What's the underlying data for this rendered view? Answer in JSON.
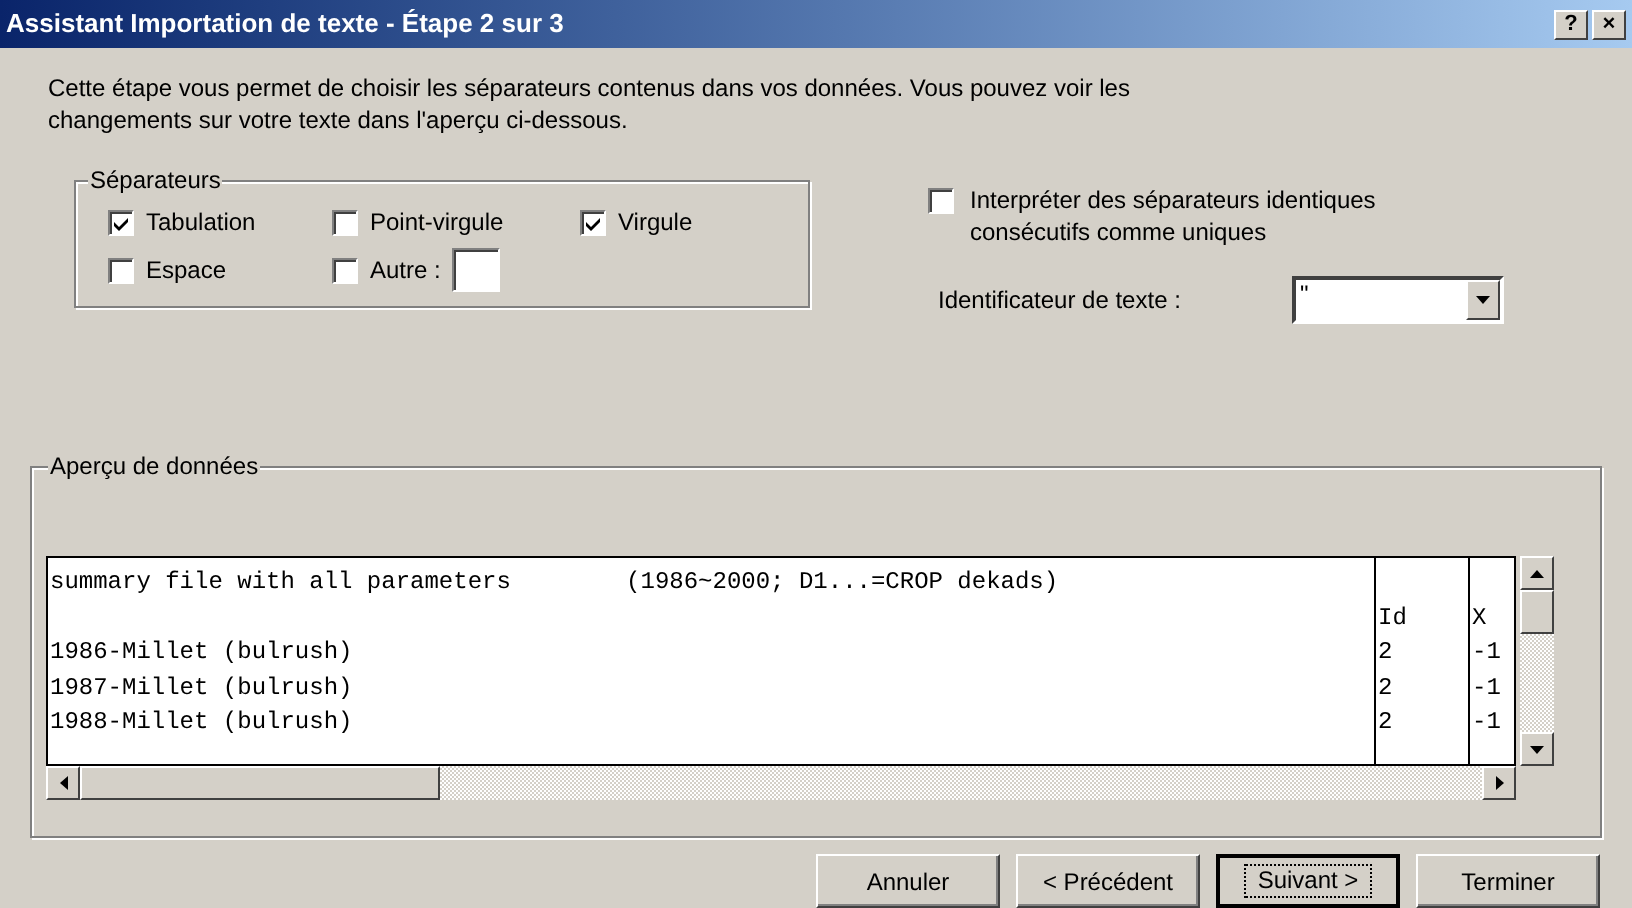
{
  "window": {
    "title": "Assistant Importation de texte - Étape 2 sur 3",
    "title_buttons": [
      "?",
      "×"
    ]
  },
  "intro": "Cette étape vous permet de choisir les séparateurs contenus dans vos données. Vous pouvez voir les changements sur votre texte dans l'aperçu ci-dessous.",
  "separators": {
    "title": "Séparateurs",
    "options": [
      {
        "label": "Tabulation",
        "checked": true
      },
      {
        "label": "Point-virgule",
        "checked": false
      },
      {
        "label": "Virgule",
        "checked": true
      },
      {
        "label": "Espace",
        "checked": false
      },
      {
        "label": "Autre :",
        "checked": false
      }
    ]
  },
  "consecutive": {
    "label": "Interpréter des séparateurs identiques consécutifs comme uniques",
    "checked": false
  },
  "text_qualifier": {
    "label": "Identificateur de texte :",
    "value": "\""
  },
  "preview": {
    "title": "Aperçu de données",
    "rows": [
      [
        "summary file with all parameters        (1986~2000; D1...=CROP dekads)",
        "",
        ""
      ],
      [
        "",
        "Id",
        "X"
      ],
      [
        "1986-Millet (bulrush)",
        "2",
        "-1"
      ],
      [
        "1987-Millet (bulrush)",
        "2",
        "-1"
      ],
      [
        "1988-Millet (bulrush)",
        "2",
        "-1"
      ]
    ]
  },
  "buttons": [
    {
      "label": "Annuler",
      "default": false
    },
    {
      "label": "< Précédent",
      "default": false
    },
    {
      "label": "Suivant >",
      "default": true
    },
    {
      "label": "Terminer",
      "default": false
    }
  ]
}
